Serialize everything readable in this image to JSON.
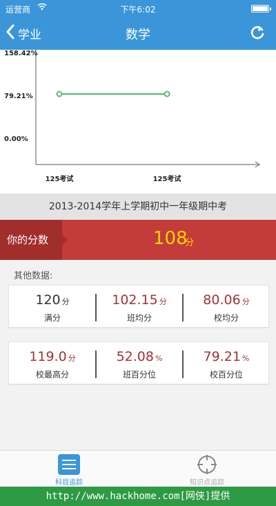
{
  "status_bar": {
    "carrier": "运营商",
    "time": "下午6:02"
  },
  "nav": {
    "back_label": "学业",
    "title": "数学"
  },
  "chart_data": {
    "type": "line",
    "x": [
      "125考试",
      "125考试"
    ],
    "y_ticks": [
      "158.42%",
      "79.21%",
      "0.00%"
    ],
    "ylim": [
      0,
      158.42
    ],
    "series": [
      {
        "values": [
          79.21,
          79.21
        ]
      }
    ],
    "line_color": "#5cbb74"
  },
  "exam": {
    "title": "2013-2014学年上学期初中一年级期中考"
  },
  "score": {
    "label": "你的分数",
    "value": "108",
    "unit": "分"
  },
  "other": {
    "label": "其他数据:"
  },
  "stats_row1": [
    {
      "value": "120",
      "unit": "分",
      "label": "满分"
    },
    {
      "value": "102.15",
      "unit": "分",
      "label": "班均分"
    },
    {
      "value": "80.06",
      "unit": "分",
      "label": "校均分"
    }
  ],
  "stats_row2": [
    {
      "value": "119.0",
      "unit": "分",
      "label": "校最高分"
    },
    {
      "value": "52.08",
      "unit": "%",
      "label": "班百分位"
    },
    {
      "value": "79.21",
      "unit": "%",
      "label": "校百分位"
    }
  ],
  "tabs": [
    {
      "label": "科目追踪",
      "icon": "list-icon",
      "active": true
    },
    {
      "label": "知识点追踪",
      "icon": "crosshair-icon",
      "active": false
    }
  ],
  "footer": {
    "text": "http://www.hackhome.com[网侠]提供"
  },
  "colors": {
    "nav": "#3a96d8",
    "score_strip": "#c43c3a",
    "score_value": "#ffd200",
    "stat_red": "#a23234"
  }
}
